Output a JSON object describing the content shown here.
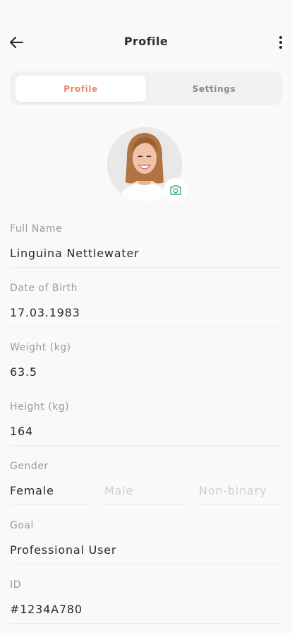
{
  "header": {
    "title": "Profile",
    "back_icon": "arrow-left-icon",
    "menu_icon": "more-vertical-icon"
  },
  "tabs": [
    {
      "label": "Profile",
      "active": true
    },
    {
      "label": "Settings",
      "active": false
    }
  ],
  "avatar": {
    "camera_icon": "camera-icon",
    "accent": "#3fae8f"
  },
  "fields": {
    "full_name": {
      "label": "Full Name",
      "value": "Linguina Nettlewater"
    },
    "dob": {
      "label": "Date of Birth",
      "value": "17.03.1983"
    },
    "weight": {
      "label": "Weight (kg)",
      "value": "63.5"
    },
    "height": {
      "label": "Height (kg)",
      "value": "164"
    },
    "gender": {
      "label": "Gender",
      "options": [
        "Female",
        "Male",
        "Non-binary"
      ],
      "selected": "Female"
    },
    "goal": {
      "label": "Goal",
      "value": "Professional User"
    },
    "id": {
      "label": "ID",
      "value": "#1234A780"
    }
  },
  "colors": {
    "accent_tab": "#ea8a6e",
    "background": "#f9f9f9"
  }
}
